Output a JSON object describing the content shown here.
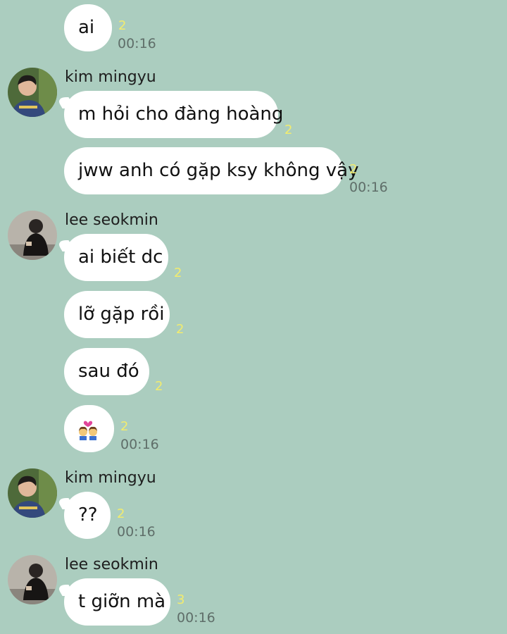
{
  "messages": [
    {
      "text": "ai",
      "unread": "2",
      "time": "00:16"
    },
    {
      "sender": "kim mingyu",
      "text": "m hỏi cho đàng hoàng",
      "unread": "2"
    },
    {
      "text": "jww anh có gặp ksy không vậy",
      "unread": "2",
      "time": "00:16"
    },
    {
      "sender": "lee seokmin",
      "text": "ai biết dc",
      "unread": "2"
    },
    {
      "text": "lỡ gặp rồi",
      "unread": "2"
    },
    {
      "text": "sau đó",
      "unread": "2"
    },
    {
      "emoji": "couple-emoji",
      "unread": "2",
      "time": "00:16"
    },
    {
      "sender": "kim mingyu",
      "text": "??",
      "unread": "2",
      "time": "00:16"
    },
    {
      "sender": "lee seokmin",
      "text": "t giỡn mà",
      "unread": "3",
      "time": "00:16"
    }
  ],
  "colors": {
    "background": "#abcdbf",
    "bubble": "#ffffff",
    "unread": "#f2ec6e",
    "time": "#5f6e69"
  }
}
